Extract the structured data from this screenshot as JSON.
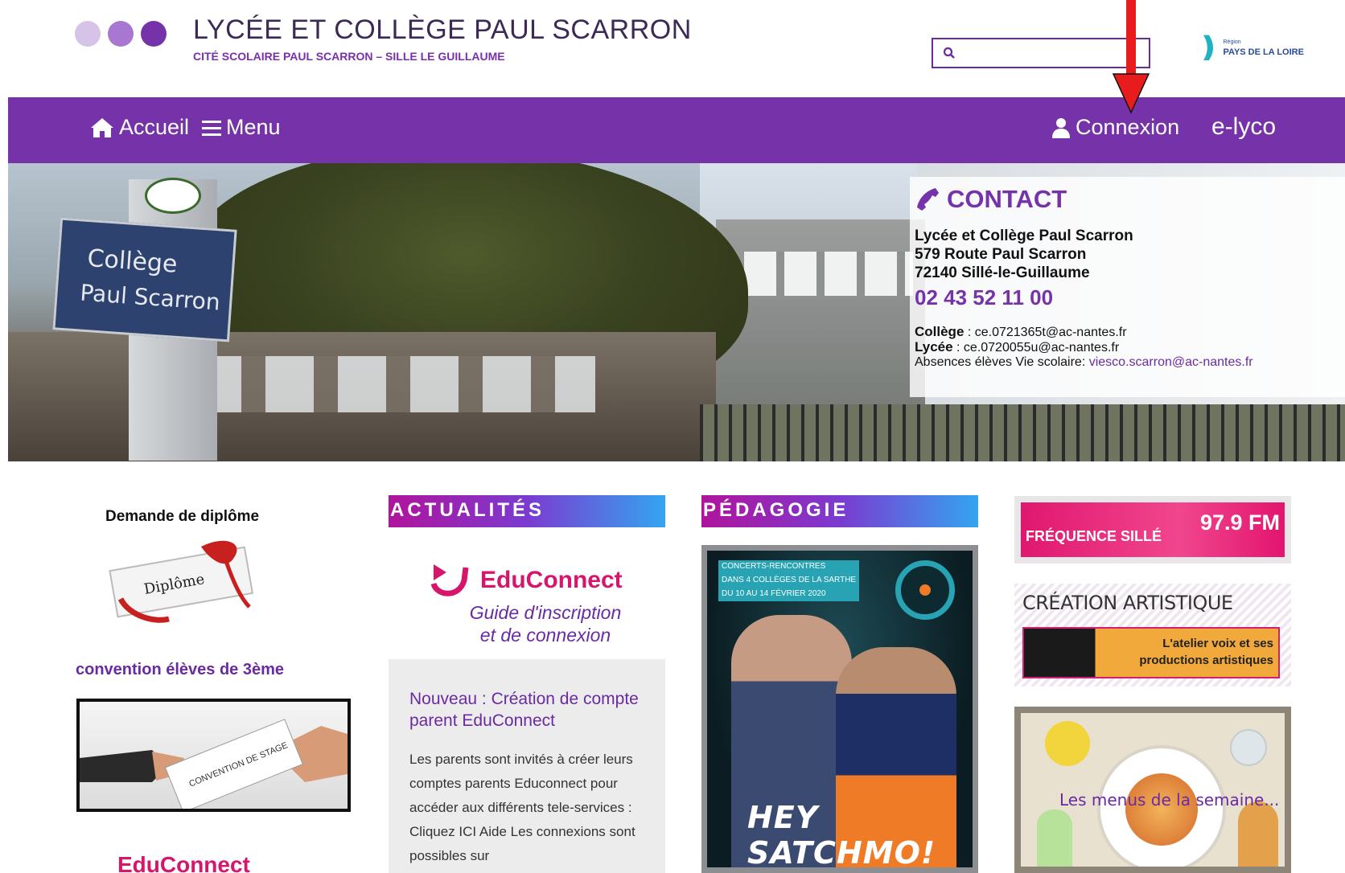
{
  "header": {
    "title": "LYCÉE ET COLLÈGE PAUL SCARRON",
    "subtitle": "CITÉ SCOLAIRE PAUL SCARRON – SILLE LE GUILLAUME",
    "dot_colors": [
      "#d6c3e8",
      "#a877d1",
      "#7633a9"
    ],
    "search": {
      "placeholder": "",
      "value": ""
    },
    "region_logo": "PAYS DE LA LOIRE",
    "region_logo_small": "Région"
  },
  "nav": {
    "home_label": "Accueil",
    "menu_label": "Menu",
    "login_label": "Connexion",
    "elyco_label": "e-lyco",
    "color": "#7633a9"
  },
  "hero": {
    "sign_line1": "Collège",
    "sign_line2": "Paul Scarron"
  },
  "contact": {
    "heading": "CONTACT",
    "address_line1": "Lycée et Collège Paul Scarron",
    "address_line2": "579 Route Paul Scarron",
    "address_line3": "72140 Sillé-le-Guillaume",
    "phone": "02 43 52 11 00",
    "college_label": "Collège",
    "college_email": " : ce.0721365t@ac-nantes.fr",
    "lycee_label": "Lycée",
    "lycee_email": " : ce.0720055u@ac-nantes.fr",
    "absences_label": "Absences élèves Vie scolaire: ",
    "absences_email": "viesco.scarron@ac-nantes.fr"
  },
  "left_column": {
    "diploma_title": "Demande de diplôme",
    "diploma_image_text": "Diplôme",
    "convention_title": "convention élèves de 3ème",
    "convention_image_text": "CONVENTION DE STAGE",
    "educonnect_bottom": "EduConnect"
  },
  "actualites": {
    "section_title": "ACTUALITÉS",
    "educonnect_name": "EduConnect",
    "educonnect_sub_line1": "Guide d'inscription",
    "educonnect_sub_line2": "et de connexion",
    "news_title": "Nouveau : Création de compte parent EduConnect",
    "news_body": "Les parents sont invités à créer leurs comptes parents Educonnect pour accéder aux différents tele-services : Cliquez ICI Aide Les connexions sont possibles sur"
  },
  "pedagogie": {
    "section_title": "PÉDAGOGIE",
    "poster_tag_line1": "CONCERTS-RENCONTRES",
    "poster_tag_line2": "DANS 4 COLLÈGES DE LA SARTHE",
    "poster_tag_line3": "DU 10 AU 14 FÉVRIER 2020",
    "poster_title": "HEY SATCHMO!"
  },
  "right_column": {
    "radio_name": "FRÉQUENCE SILLÉ",
    "radio_freq": "97.9 FM",
    "creation_title": "CRÉATION ARTISTIQUE",
    "creation_band_line1": "L'atelier voix et ses",
    "creation_band_line2": "productions artistiques",
    "menus_label": "Les menus de la semaine..."
  }
}
